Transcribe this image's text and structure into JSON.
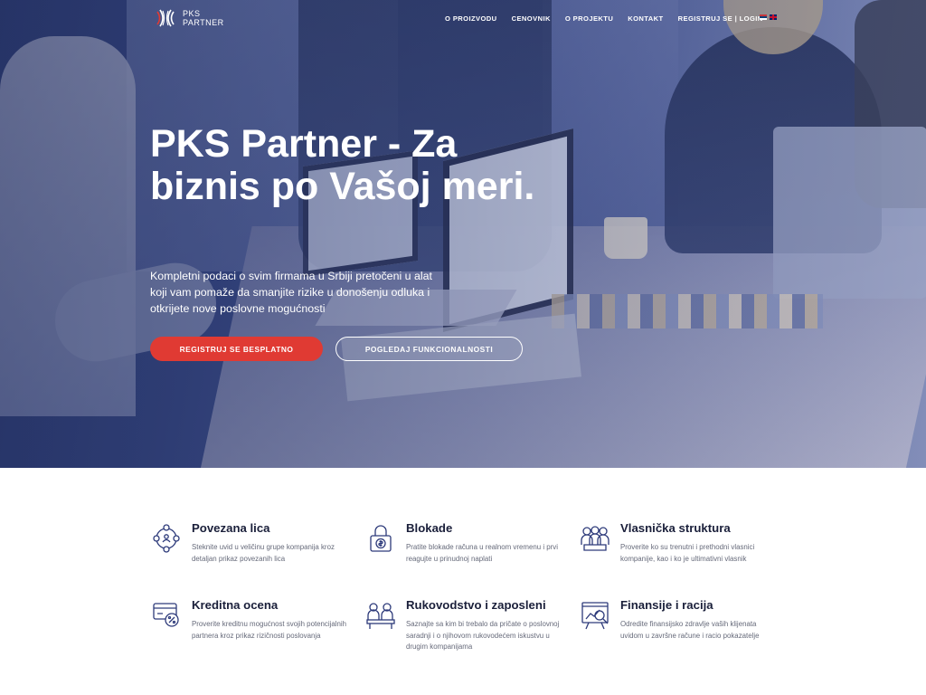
{
  "logo": {
    "line1": "PKS",
    "line2": "PARTNER"
  },
  "nav": {
    "items": [
      "O PROIZVODU",
      "CENOVNIK",
      "O PROJEKTU",
      "KONTAKT",
      "REGISTRUJ SE | LOGIN"
    ]
  },
  "hero": {
    "title": "PKS Partner - Za biznis po Vašoj meri.",
    "subtitle": "Kompletni podaci o svim firmama u Srbiji pretočeni u alat koji vam pomaže da smanjite rizike u donošenju odluka i otkrijete nove poslovne mogućnosti",
    "primary_button": "REGISTRUJ SE BESPLATNO",
    "secondary_button": "POGLEDAJ FUNKCIONALNOSTI"
  },
  "features": [
    {
      "title": "Povezana lica",
      "text": "Steknite uvid u veličinu grupe kompanija kroz detaljan prikaz povezanih lica",
      "icon": "network-people-icon"
    },
    {
      "title": "Blokade",
      "text": "Pratite blokade računa u realnom vremenu i prvi reagujte u prinudnoj naplati",
      "icon": "padlock-dollar-icon"
    },
    {
      "title": "Vlasnička struktura",
      "text": "Proverite ko su trenutni i prethodni vlasnici kompanije, kao i ko je ultimativni vlasnik",
      "icon": "owners-group-icon"
    },
    {
      "title": "Kreditna ocena",
      "text": "Proverite kreditnu mogućnost svojih potencijalnih partnera kroz prikaz rizičnosti poslovanja",
      "icon": "credit-card-percent-icon"
    },
    {
      "title": "Rukovodstvo i zaposleni",
      "text": "Saznajte sa kim bi trebalo da pričate o poslovnoj saradnji i o njihovom rukovodećem iskustvu u drugim kompanijama",
      "icon": "management-desk-icon"
    },
    {
      "title": "Finansije i racija",
      "text": "Odredite finansijsko zdravlje vaših klijenata uvidom u završne račune i racio pokazatelje",
      "icon": "financial-chart-icon"
    }
  ],
  "colors": {
    "accent": "#e03a33",
    "hero": "#3a4b86",
    "icon": "#2d3a7a",
    "heading": "#1a1f3a"
  }
}
